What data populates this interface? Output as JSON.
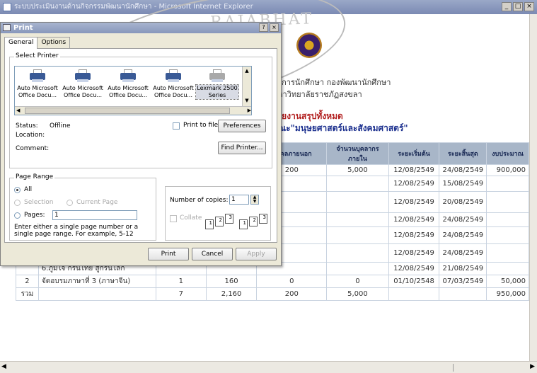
{
  "browser": {
    "title": "ระบบประเมินงานด้านกิจกรรมพัฒนานักศึกษา - Microsoft Internet Explorer",
    "window_buttons": [
      "_",
      "□",
      "×"
    ]
  },
  "page": {
    "header_line1": "กิจการนักศึกษา กองพัฒนานักศึกษา",
    "header_line2": "มหาวิทยาลัยราชภัฏสงขลา",
    "red_heading": "รายงานสรุปทั้งหมด",
    "faculty_heading": "คณะ\"มนุษยศาสตร์และสังคมศาสตร์\"",
    "watermark_text": "RAJABHAT",
    "table": {
      "headers": [
        "บุคคลภายนอก",
        "จำนวนบุคลากรภายใน",
        "ระยะเริ่มต้น",
        "ระยะสิ้นสุด",
        "งบประมาณ"
      ],
      "rows": [
        {
          "no": "",
          "name": "",
          "c1": "",
          "c2": "",
          "c3": "200",
          "c4": "5,000",
          "start": "12/08/2549",
          "end": "24/08/2549",
          "budget": "900,000"
        },
        {
          "no": "",
          "name": "",
          "c1": "",
          "c2": "",
          "c3": "",
          "c4": "",
          "start": "12/08/2549",
          "end": "15/08/2549",
          "budget": ""
        },
        {
          "no": "",
          "name": "",
          "c1": "",
          "c2": "",
          "c3": "",
          "c4": "",
          "start": "12/08/2549",
          "end": "20/08/2549",
          "budget": ""
        },
        {
          "no": "",
          "name": "",
          "c1": "",
          "c2": "",
          "c3": "",
          "c4": "",
          "start": "12/08/2549",
          "end": "24/08/2549",
          "budget": ""
        },
        {
          "no": "",
          "name": "",
          "c1": "",
          "c2": "",
          "c3": "",
          "c4": "",
          "start": "12/08/2549",
          "end": "24/08/2549",
          "budget": ""
        },
        {
          "no": "",
          "name": "",
          "c1": "",
          "c2": "",
          "c3": "",
          "c4": "",
          "start": "12/08/2549",
          "end": "24/08/2549",
          "budget": ""
        },
        {
          "no": "",
          "name": "6.ภูมิใจ กรีนไทย สู่กรีนโลก",
          "c1": "",
          "c2": "",
          "c3": "",
          "c4": "",
          "start": "12/08/2549",
          "end": "21/08/2549",
          "budget": ""
        },
        {
          "no": "2",
          "name": "จัดอบรมภาษาที่ 3 (ภาษาจีน)",
          "c1": "1",
          "c2": "160",
          "c3": "0",
          "c4": "0",
          "start": "01/10/2548",
          "end": "07/03/2549",
          "budget": "50,000"
        },
        {
          "no": "รวม",
          "name": "",
          "c1": "7",
          "c2": "2,160",
          "c3": "200",
          "c4": "5,000",
          "start": "",
          "end": "",
          "budget": "950,000"
        }
      ]
    }
  },
  "dialog": {
    "title": "Print",
    "title_buttons": [
      "?",
      "×"
    ],
    "tabs": [
      "General",
      "Options"
    ],
    "select_printer_label": "Select Printer",
    "printers": [
      {
        "name": "Auto Microsoft Office Docu...",
        "icon": "printer-icon"
      },
      {
        "name": "Auto Microsoft Office Docu...",
        "icon": "printer-icon"
      },
      {
        "name": "Auto Microsoft Office Docu...",
        "icon": "printer-icon"
      },
      {
        "name": "Auto Microsoft Office Docu...",
        "icon": "printer-icon"
      },
      {
        "name": "Lexmark 2500 Series",
        "icon": "printer-icon"
      }
    ],
    "status_label": "Status:",
    "status_value": "Offline",
    "location_label": "Location:",
    "comment_label": "Comment:",
    "print_to_file_label": "Print to file",
    "preferences_label": "Preferences",
    "find_printer_label": "Find Printer...",
    "page_range_label": "Page Range",
    "range_all": "All",
    "range_selection": "Selection",
    "range_current": "Current Page",
    "range_pages": "Pages:",
    "pages_value": "1",
    "hint": "Enter either a single page number or a single page range.  For example, 5-12",
    "copies_label": "Number of copies:",
    "copies_value": "1",
    "collate_label": "Collate",
    "collate_pages": [
      "1",
      "2",
      "3",
      "1",
      "2",
      "3"
    ],
    "print_button": "Print",
    "cancel_button": "Cancel",
    "apply_button": "Apply"
  }
}
